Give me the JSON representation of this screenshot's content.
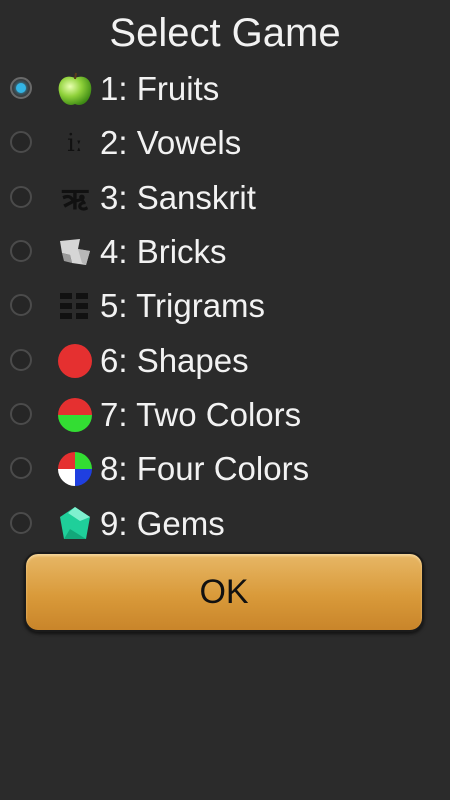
{
  "title": "Select Game",
  "options": [
    {
      "label": "1: Fruits",
      "icon": "apple-icon",
      "selected": true
    },
    {
      "label": "2: Vowels",
      "icon": "vowel-icon",
      "icon_text": "iː",
      "selected": false
    },
    {
      "label": "3: Sanskrit",
      "icon": "sanskrit-icon",
      "icon_text": "ऋ",
      "selected": false
    },
    {
      "label": "4: Bricks",
      "icon": "brick-icon",
      "selected": false
    },
    {
      "label": "5: Trigrams",
      "icon": "trigram-icon",
      "selected": false
    },
    {
      "label": "6: Shapes",
      "icon": "red-circle-icon",
      "selected": false
    },
    {
      "label": "7: Two Colors",
      "icon": "two-color-circle-icon",
      "selected": false
    },
    {
      "label": "8: Four Colors",
      "icon": "four-color-circle-icon",
      "selected": false
    },
    {
      "label": "9: Gems",
      "icon": "gem-icon",
      "selected": false
    }
  ],
  "ok_label": "OK",
  "colors": {
    "background": "#2b2b2b",
    "radio_selected": "#33b5e5",
    "button": "#d99a3a"
  }
}
